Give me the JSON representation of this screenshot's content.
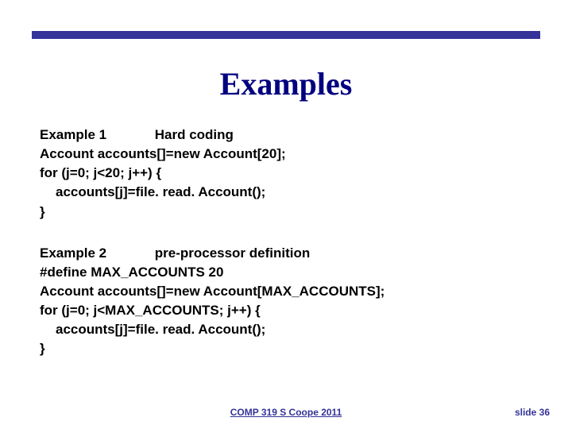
{
  "title": "Examples",
  "example1": {
    "label": "Example 1",
    "subtitle": "Hard coding",
    "lines": [
      "Account accounts[]=new Account[20];",
      "for (j=0; j<20; j++) {",
      "accounts[j]=file. read. Account();",
      "}"
    ]
  },
  "example2": {
    "label": "Example 2",
    "subtitle": "pre-processor definition",
    "lines": [
      "#define  MAX_ACCOUNTS 20",
      "Account accounts[]=new Account[MAX_ACCOUNTS];",
      "for (j=0; j<MAX_ACCOUNTS; j++) {",
      "accounts[j]=file. read. Account();",
      "}"
    ]
  },
  "footer": {
    "center": "COMP 319 S Coope 2011",
    "right": "slide 36"
  }
}
